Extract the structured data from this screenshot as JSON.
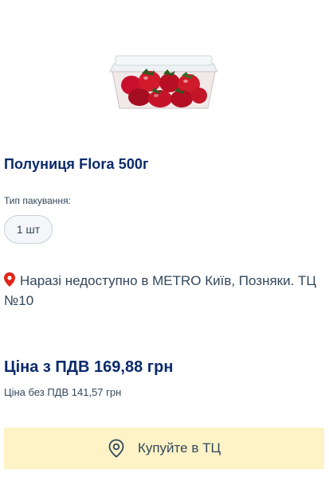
{
  "product": {
    "title": "Полуниця Flora 500г",
    "image_icon": "strawberry-container-image"
  },
  "packaging": {
    "label": "Тип пакування:",
    "options": [
      "1 шт"
    ],
    "selected": "1 шт"
  },
  "availability": {
    "icon": "location-pin-icon",
    "text": "Наразі недоступно в METRO Київ, Позняки. ТЦ №10",
    "pin_color": "#e1251b"
  },
  "price": {
    "with_vat": "Ціна з ПДВ 169,88 грн",
    "without_vat": "Ціна без ПДВ 141,57 грн"
  },
  "actions": {
    "buy_in_store_label": "Купуйте в ТЦ",
    "buy_in_store_icon": "location-pin-outline-icon",
    "button_color": "#fdf3c6"
  },
  "colors": {
    "title": "#0b2a6b",
    "text": "#33475b"
  }
}
